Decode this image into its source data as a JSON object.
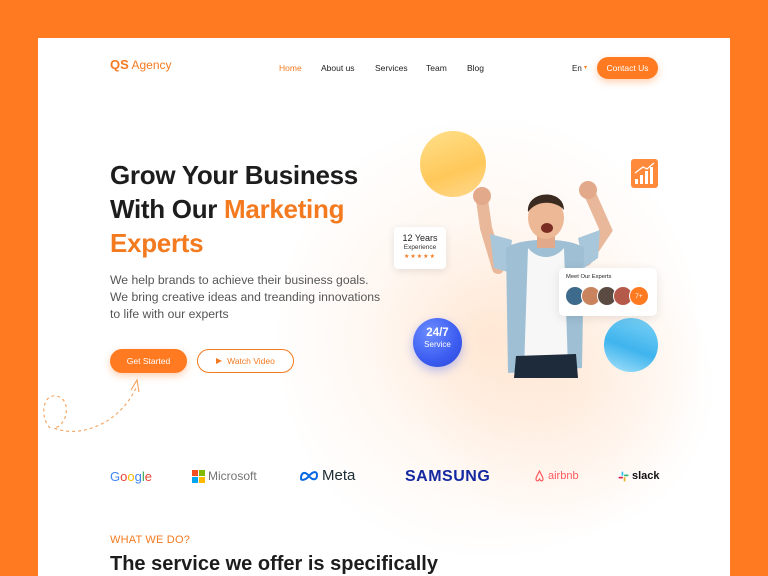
{
  "brand": {
    "bold": "QS",
    "rest": " Agency"
  },
  "nav": {
    "items": [
      {
        "label": "Home",
        "active": true
      },
      {
        "label": "About us",
        "active": false
      },
      {
        "label": "Services",
        "active": false
      },
      {
        "label": "Team",
        "active": false
      },
      {
        "label": "Blog",
        "active": false
      }
    ],
    "language": "En",
    "contact_label": "Contact Us"
  },
  "hero": {
    "title_line1": "Grow Your Business",
    "title_line2_a": "With Our ",
    "title_line2_b": "Marketing",
    "title_line3": "Experts",
    "lead": "We help brands to achieve their business goals. We bring creative ideas and treanding innovations to life with our experts",
    "primary_cta": "Get Started",
    "secondary_cta": "Watch Video"
  },
  "experience_card": {
    "years": "12 Years",
    "label": "Experience",
    "stars": "★★★★★",
    "rating_stars": 5
  },
  "service_badge": {
    "number": "24/7",
    "label": "Service"
  },
  "experts_card": {
    "title": "Meet Our Experts",
    "more": "7+"
  },
  "partners": {
    "google": "Google",
    "microsoft": "Microsoft",
    "meta": "Meta",
    "samsung": "SAMSUNG",
    "airbnb": "airbnb",
    "slack": "slack"
  },
  "services": {
    "eyebrow": "WHAT WE DO?",
    "title": "The service we offer is specifically"
  },
  "colors": {
    "accent": "#FF7A21",
    "text": "#1D1D1D",
    "badge_blue": "#3B5CF0"
  }
}
